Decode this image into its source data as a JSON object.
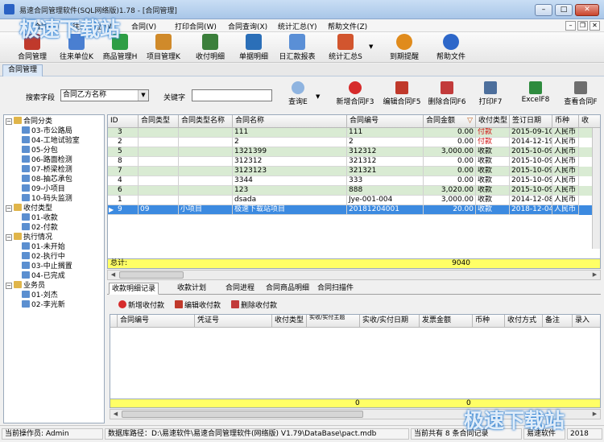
{
  "window": {
    "title": "易速合同管理软件(SQL网络版)1.78 - [合同管理]"
  },
  "watermark": {
    "top_left": "极速下载站",
    "bottom_right": "极速下载站"
  },
  "menu": [
    "合同(C)",
    "往来单位(W)",
    "合同(V)",
    "打印合同(W)",
    "合同查询(X)",
    "统计汇总(Y)",
    "帮助文件(Z)"
  ],
  "toolbar": [
    {
      "label": "合同管理",
      "icon": "contract-manage-icon",
      "color": "#c0392b"
    },
    {
      "label": "往来单位K",
      "icon": "contacts-icon",
      "color": "#4a7fd1"
    },
    {
      "label": "商品管理H",
      "icon": "goods-manage-icon",
      "color": "#2e9e44"
    },
    {
      "label": "项目管理K",
      "icon": "project-manage-icon",
      "color": "#d08a2a"
    },
    {
      "label": "收付明细",
      "icon": "payment-detail-icon",
      "color": "#3b7f3b"
    },
    {
      "label": "单据明细",
      "icon": "receipt-detail-icon",
      "color": "#2b6fb8"
    },
    {
      "label": "日汇款报表",
      "icon": "daily-report-icon",
      "color": "#5a8fd6"
    },
    {
      "label": "统计汇总S",
      "icon": "statistics-icon",
      "color": "#d2552e"
    },
    {
      "label": "到期提醒",
      "icon": "alarm-clock-icon",
      "color": "#e08b1c"
    },
    {
      "label": "帮助文件",
      "icon": "help-icon",
      "color": "#2d67c9"
    }
  ],
  "tab": {
    "label": "合同管理"
  },
  "search": {
    "field_label": "搜索字段",
    "field_value": "合同乙方名称",
    "keyword_label": "关键字",
    "keyword_value": "",
    "query_label": "查询E"
  },
  "actions": [
    {
      "label": "新增合同F3",
      "icon": "add-contract-icon",
      "color": "#d62b2b"
    },
    {
      "label": "编辑合同F5",
      "icon": "edit-contract-icon",
      "color": "#c0392b"
    },
    {
      "label": "删除合同F6",
      "icon": "delete-contract-icon",
      "color": "#c23b3b"
    },
    {
      "label": "打印F7",
      "icon": "print-icon",
      "color": "#4d6f9c"
    },
    {
      "label": "ExcelF8",
      "icon": "excel-icon",
      "color": "#2e8b3e"
    },
    {
      "label": "查看合同F",
      "icon": "view-contract-icon",
      "color": "#6e6e6e"
    }
  ],
  "tree": [
    {
      "label": "合同分类",
      "level": 0,
      "icon": "folder-icon"
    },
    {
      "label": "03-市公路局",
      "level": 1
    },
    {
      "label": "04-工地试验室",
      "level": 1
    },
    {
      "label": "05-分包",
      "level": 1
    },
    {
      "label": "06-路面检测",
      "level": 1
    },
    {
      "label": "07-桥梁检测",
      "level": 1
    },
    {
      "label": "08-抽芯承包",
      "level": 1
    },
    {
      "label": "09-小项目",
      "level": 1
    },
    {
      "label": "10-码头监测",
      "level": 1
    },
    {
      "label": "收付类型",
      "level": 0,
      "icon": "folder-icon"
    },
    {
      "label": "01-收款",
      "level": 1
    },
    {
      "label": "02-付款",
      "level": 1
    },
    {
      "label": "执行情况",
      "level": 0,
      "icon": "folder-icon"
    },
    {
      "label": "01-未开始",
      "level": 1
    },
    {
      "label": "02-执行中",
      "level": 1
    },
    {
      "label": "03-中止搁置",
      "level": 1
    },
    {
      "label": "04-已完成",
      "level": 1
    },
    {
      "label": "业务员",
      "level": 0,
      "icon": "folder-icon"
    },
    {
      "label": "01-刘杰",
      "level": 1
    },
    {
      "label": "02-李光新",
      "level": 1
    }
  ],
  "grid": {
    "columns": [
      "ID",
      "合同类型",
      "合同类型名称",
      "合同名称",
      "合同编号",
      "合同金额",
      "收付类型",
      "签订日期",
      "币种",
      "收"
    ],
    "rows": [
      [
        "3",
        "",
        "",
        "111",
        "111",
        "0.00",
        "付款",
        "2015-09-10",
        "人民币"
      ],
      [
        "2",
        "",
        "",
        "2",
        "2",
        "0.00",
        "付款",
        "2014-12-19",
        "人民币"
      ],
      [
        "5",
        "",
        "",
        "1321399",
        "312312",
        "3,000.00",
        "收款",
        "2015-10-09",
        "人民币"
      ],
      [
        "8",
        "",
        "",
        "312312",
        "321312",
        "0.00",
        "收款",
        "2015-10-09",
        "人民币"
      ],
      [
        "7",
        "",
        "",
        "3123123",
        "321321",
        "0.00",
        "收款",
        "2015-10-09",
        "人民币"
      ],
      [
        "4",
        "",
        "",
        "3344",
        "333",
        "0.00",
        "收款",
        "2015-10-09",
        "人民币"
      ],
      [
        "6",
        "",
        "",
        "123",
        "888",
        "3,020.00",
        "收款",
        "2015-10-09",
        "人民币"
      ],
      [
        "1",
        "",
        "",
        "dsada",
        "Jye-001-004",
        "3,000.00",
        "收款",
        "2014-12-08",
        "人民币"
      ],
      [
        "9",
        "09",
        "小项目",
        "极速下载站项目",
        "20181204001",
        "20.00",
        "收款",
        "2018-12-04",
        "人民币"
      ]
    ],
    "total_label": "总计:",
    "total_value": "9040"
  },
  "bottom_tabs": [
    "收款明细记录",
    "收款计划",
    "合同进程",
    "合同商品明细",
    "合同扫描件"
  ],
  "bottom_actions": [
    {
      "label": "新增收付款",
      "icon": "add-payment-icon",
      "color": "#d62b2b"
    },
    {
      "label": "编辑收付款",
      "icon": "edit-payment-icon",
      "color": "#c0392b"
    },
    {
      "label": "删除收付款",
      "icon": "delete-payment-icon",
      "color": "#c23b3b"
    }
  ],
  "detail_grid": {
    "columns": [
      "合同编号",
      "凭证号",
      "收付类型",
      "实收/实付主题",
      "实收/实付日期",
      "发票金额",
      "币种",
      "收付方式",
      "备注",
      "录入"
    ],
    "total_left": "0",
    "total_right": "0"
  },
  "status": {
    "operator": "当前操作员: Admin",
    "db_path": "数据库路径：D:\\易速软件\\易速合同管理软件(网络版) V1.79\\DataBase\\pact.mdb",
    "record_count": "当前共有 8 条合同记录",
    "brand": "易速软件",
    "year": "2018"
  }
}
